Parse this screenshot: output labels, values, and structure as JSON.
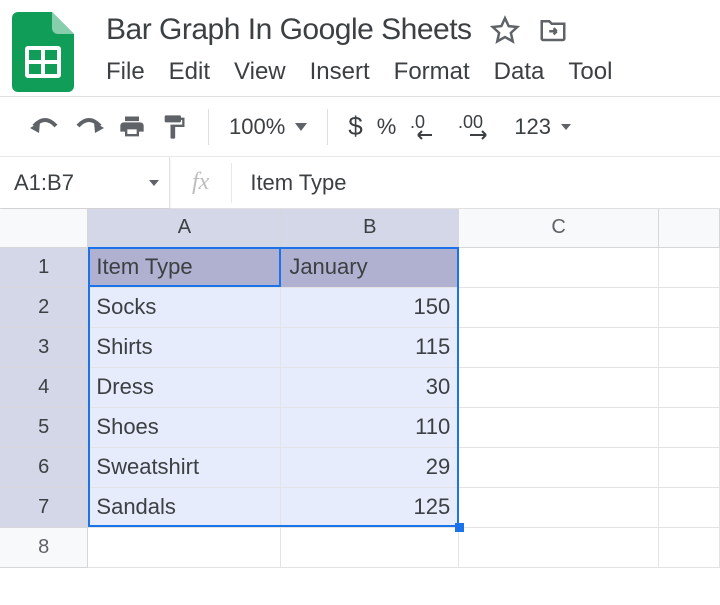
{
  "doc": {
    "title": "Bar Graph In Google Sheets"
  },
  "menu": {
    "file": "File",
    "edit": "Edit",
    "view": "View",
    "insert": "Insert",
    "format": "Format",
    "data": "Data",
    "tools": "Tool"
  },
  "toolbar": {
    "zoom": "100%",
    "currency": "$",
    "percent": "%",
    "dec_decrease": ".0",
    "dec_increase": ".00",
    "more_formats": "123"
  },
  "fxbar": {
    "range": "A1:B7",
    "fx_label": "fx",
    "formula": "Item Type"
  },
  "columns": {
    "A": "A",
    "B": "B",
    "C": "C"
  },
  "rows": [
    "1",
    "2",
    "3",
    "4",
    "5",
    "6",
    "7",
    "8"
  ],
  "sheet": {
    "header": {
      "A": "Item Type",
      "B": "January"
    },
    "data": [
      {
        "item": "Socks",
        "jan": "150"
      },
      {
        "item": "Shirts",
        "jan": "115"
      },
      {
        "item": "Dress",
        "jan": "30"
      },
      {
        "item": "Shoes",
        "jan": "110"
      },
      {
        "item": "Sweatshirt",
        "jan": "29"
      },
      {
        "item": "Sandals",
        "jan": "125"
      }
    ]
  },
  "chart_data": {
    "type": "bar",
    "title": "Bar Graph In Google Sheets",
    "xlabel": "Item Type",
    "ylabel": "January",
    "categories": [
      "Socks",
      "Shirts",
      "Dress",
      "Shoes",
      "Sweatshirt",
      "Sandals"
    ],
    "values": [
      150,
      115,
      30,
      110,
      29,
      125
    ]
  }
}
